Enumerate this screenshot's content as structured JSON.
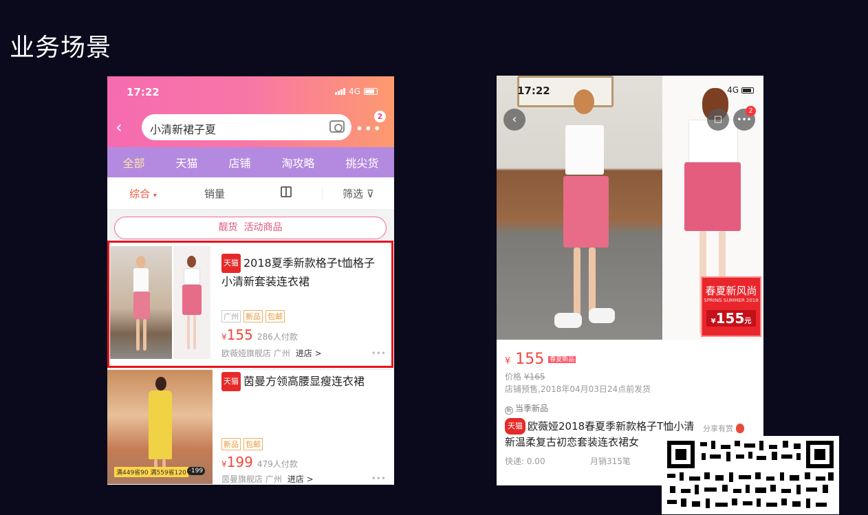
{
  "slide": {
    "title": "业务场景"
  },
  "phone1": {
    "time": "17:22",
    "network": "4G",
    "search": {
      "query": "小清新裙子夏",
      "back": "‹"
    },
    "more": {
      "dots": "•••",
      "badge": "2"
    },
    "tabs": [
      "全部",
      "天猫",
      "店铺",
      "淘攻略",
      "挑尖货"
    ],
    "sort": {
      "composite": "综合",
      "composite_arrow": "▾",
      "sales": "销量",
      "filter": "筛选",
      "filter_icon": "⊽"
    },
    "promo": {
      "label": "靓货",
      "text": "活动商品"
    },
    "items": [
      {
        "tmall": "天猫",
        "title": "2018夏季新款格子t恤格子小清新套装连衣裙",
        "tags": [
          "广州",
          "新品",
          "包邮"
        ],
        "currency": "¥",
        "price": "155",
        "buyers": "286人付款",
        "shop": "欧薇娅旗舰店 广州",
        "enter": "进店 >",
        "dots": "•••"
      },
      {
        "tmall": "天猫",
        "title": "茵曼方领高腰显瘦连衣裙",
        "tags": [
          "新品",
          "包邮"
        ],
        "currency": "¥",
        "price": "199",
        "buyers": "479人付款",
        "shop": "茵曼旗舰店 广州",
        "enter": "进店 >",
        "dots": "•••",
        "coupon": "满449省90 满559省120",
        "coupon_price": "·199"
      }
    ]
  },
  "phone2": {
    "time": "17:22",
    "network": "4G",
    "back": "‹",
    "more": "•••",
    "cart_badge": "2",
    "spring": {
      "title": "春夏新风尚",
      "sub": "SPRING SUMMER 2018",
      "currency": "¥",
      "price": "155",
      "unit": "元"
    },
    "price": {
      "currency": "¥",
      "value": "155",
      "tag": "春夏新品"
    },
    "orig_price": {
      "label": "价格",
      "value": "¥165"
    },
    "presale": "店铺预售,2018年04月03日24点前发货",
    "new_season": "当季新品",
    "title": {
      "tmall": "天猫",
      "text": "欧薇娅2018春夏季新款格子T恤小清新温柔复古初恋套装连衣裙女"
    },
    "share": "分享有赏",
    "shipping": "快递: 0.00",
    "sales": "月销315笔"
  },
  "colors": {
    "accent": "#f0473d",
    "tab_bar": "#b48ae0",
    "highlight_box": "#e8121c",
    "tmall_red": "#e62a2a"
  }
}
